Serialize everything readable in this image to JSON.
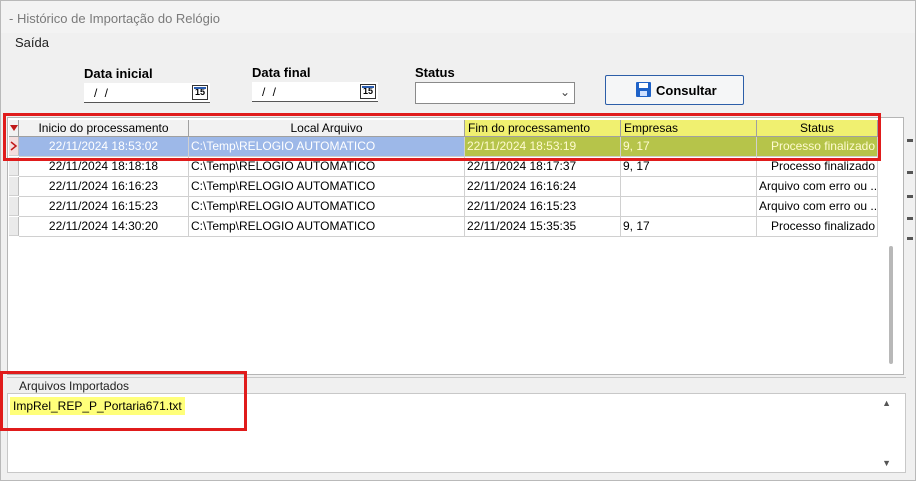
{
  "window": {
    "title": "- Histórico de Importação do Relógio"
  },
  "menu": {
    "items": [
      {
        "label": "Saída"
      }
    ]
  },
  "filters": {
    "start_date": {
      "label": "Data inicial",
      "value": "/ /",
      "calendar_icon_text": "15"
    },
    "end_date": {
      "label": "Data final",
      "value": "/ /",
      "calendar_icon_text": "15"
    },
    "status": {
      "label": "Status",
      "selected": ""
    },
    "search_button": {
      "label": "Consultar",
      "icon": "disk-icon"
    }
  },
  "grid": {
    "columns": [
      "Inicio do processamento",
      "Local Arquivo",
      "Fim do processamento",
      "Empresas",
      "Status"
    ],
    "rows": [
      {
        "inicio": "22/11/2024 18:53:02",
        "local": "C:\\Temp\\RELOGIO AUTOMATICO",
        "fim": "22/11/2024 18:53:19",
        "empresas": "9, 17",
        "status": "Processo finalizado",
        "selected": true
      },
      {
        "inicio": "22/11/2024 18:18:18",
        "local": "C:\\Temp\\RELOGIO AUTOMATICO",
        "fim": "22/11/2024 18:17:37",
        "empresas": "9, 17",
        "status": "Processo finalizado"
      },
      {
        "inicio": "22/11/2024 16:16:23",
        "local": "C:\\Temp\\RELOGIO AUTOMATICO",
        "fim": "22/11/2024 16:16:24",
        "empresas": "",
        "status": "Arquivo com erro ou ..."
      },
      {
        "inicio": "22/11/2024 16:15:23",
        "local": "C:\\Temp\\RELOGIO AUTOMATICO",
        "fim": "22/11/2024 16:15:23",
        "empresas": "",
        "status": "Arquivo com erro ou ..."
      },
      {
        "inicio": "22/11/2024 14:30:20",
        "local": "C:\\Temp\\RELOGIO AUTOMATICO",
        "fim": "22/11/2024 15:35:35",
        "empresas": "9, 17",
        "status": "Processo finalizado"
      }
    ]
  },
  "imported_files": {
    "label": "Arquivos Importados",
    "files": [
      "ImpRel_REP_P_Portaria671.txt"
    ]
  },
  "colors": {
    "highlight": "#f0f070",
    "annotation_red": "#e01b1b",
    "selection": "#9db8e8",
    "file_highlight": "#ffff7a"
  }
}
